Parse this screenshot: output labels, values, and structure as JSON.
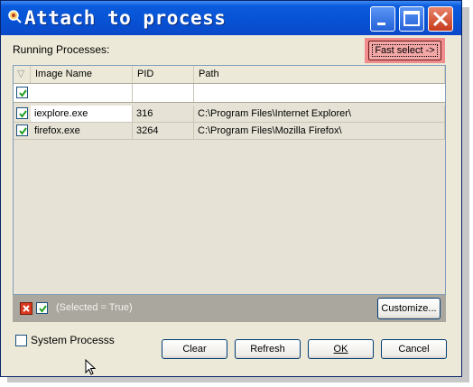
{
  "window": {
    "title": "Attach to process"
  },
  "labels": {
    "running_processes": "Running Processes:"
  },
  "buttons": {
    "fast_select": "Fast select ->",
    "customize": "Customize...",
    "clear": "Clear",
    "refresh": "Refresh",
    "ok": "OK",
    "cancel": "Cancel"
  },
  "grid": {
    "columns": [
      "Image Name",
      "PID",
      "Path"
    ],
    "rows": [
      {
        "checked": true,
        "image_name": "iexplore.exe",
        "pid": "316",
        "path": "C:\\Program Files\\Internet Explorer\\"
      },
      {
        "checked": true,
        "image_name": "firefox.exe",
        "pid": "3264",
        "path": "C:\\Program Files\\Mozilla Firefox\\"
      }
    ]
  },
  "filter": {
    "text": "(Selected = True)"
  },
  "options": {
    "system_processes_label": "System Processs",
    "system_processes_checked": false
  },
  "colors": {
    "titlebar": "#0752d4",
    "highlight": "#f08c8c",
    "filter_bar": "#a9a79e"
  }
}
